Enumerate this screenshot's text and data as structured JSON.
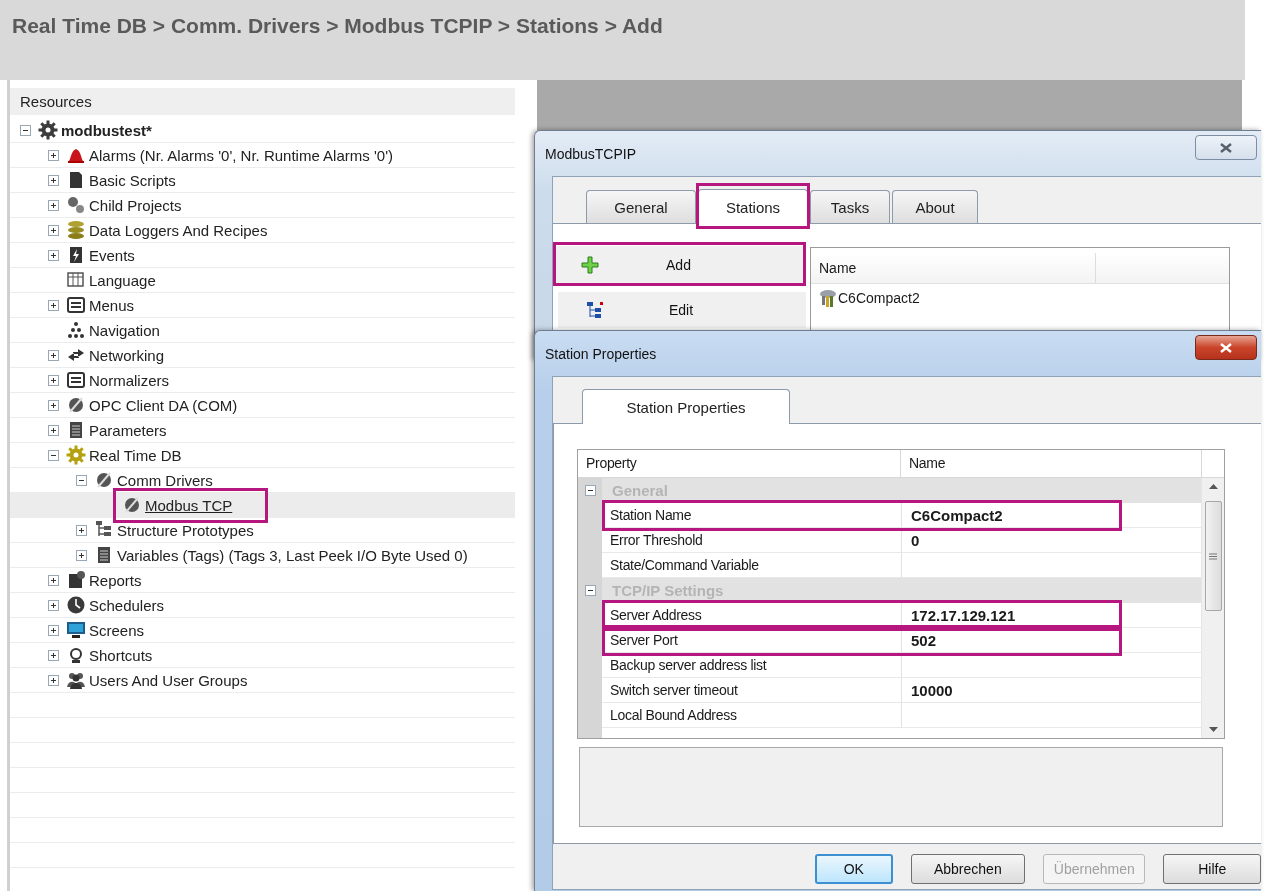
{
  "header": {
    "breadcrumb": "Real Time DB > Comm. Drivers > Modbus TCPIP > Stations > Add"
  },
  "resources": {
    "title": "Resources",
    "tree": [
      {
        "label": "modbustest*",
        "expanded": true,
        "selected": false,
        "highlighted": false,
        "children": [
          {
            "label": "Alarms (Nr. Alarms '0', Nr. Runtime Alarms '0')",
            "expanded": false,
            "selected": false,
            "highlighted": false
          },
          {
            "label": "Basic Scripts",
            "expanded": false,
            "selected": false,
            "highlighted": false
          },
          {
            "label": "Child Projects",
            "expanded": false,
            "selected": false,
            "highlighted": false
          },
          {
            "label": "Data Loggers And Recipes",
            "expanded": false,
            "selected": false,
            "highlighted": false
          },
          {
            "label": "Events",
            "expanded": false,
            "selected": false,
            "highlighted": false
          },
          {
            "label": "Language",
            "selected": false,
            "highlighted": false
          },
          {
            "label": "Menus",
            "expanded": false,
            "selected": false,
            "highlighted": false
          },
          {
            "label": "Navigation",
            "selected": false,
            "highlighted": false
          },
          {
            "label": "Networking",
            "expanded": false,
            "selected": false,
            "highlighted": false
          },
          {
            "label": "Normalizers",
            "expanded": false,
            "selected": false,
            "highlighted": false
          },
          {
            "label": "OPC Client DA (COM)",
            "expanded": false,
            "selected": false,
            "highlighted": false
          },
          {
            "label": "Parameters",
            "expanded": false,
            "selected": false,
            "highlighted": false
          },
          {
            "label": "Real Time DB",
            "expanded": true,
            "selected": false,
            "highlighted": false,
            "children": [
              {
                "label": "Comm Drivers",
                "expanded": true,
                "selected": false,
                "highlighted": false,
                "children": [
                  {
                    "label": "Modbus TCP",
                    "selected": true,
                    "highlighted": true
                  }
                ]
              },
              {
                "label": "Structure Prototypes",
                "expanded": false,
                "selected": false,
                "highlighted": false
              },
              {
                "label": "Variables (Tags) (Tags 3, Last Peek I/O Byte Used 0)",
                "expanded": false,
                "selected": false,
                "highlighted": false
              }
            ]
          },
          {
            "label": "Reports",
            "expanded": false,
            "selected": false,
            "highlighted": false
          },
          {
            "label": "Schedulers",
            "expanded": false,
            "selected": false,
            "highlighted": false
          },
          {
            "label": "Screens",
            "expanded": false,
            "selected": false,
            "highlighted": false
          },
          {
            "label": "Shortcuts",
            "expanded": false,
            "selected": false,
            "highlighted": false
          },
          {
            "label": "Users And User Groups",
            "expanded": false,
            "selected": false,
            "highlighted": false
          }
        ]
      }
    ]
  },
  "driver_window": {
    "title": "ModbusTCPIP",
    "active": false,
    "tabs": [
      {
        "label": "General",
        "selected": false,
        "highlighted": false
      },
      {
        "label": "Stations",
        "selected": true,
        "highlighted": true
      },
      {
        "label": "Tasks",
        "selected": false,
        "highlighted": false
      },
      {
        "label": "About",
        "selected": false,
        "highlighted": false
      }
    ],
    "actions": [
      {
        "label": "Add",
        "highlighted": true
      },
      {
        "label": "Edit",
        "highlighted": false
      }
    ],
    "stations_list": {
      "columns": [
        "Name"
      ],
      "rows": [
        "C6Compact2"
      ]
    }
  },
  "properties_window": {
    "title": "Station Properties",
    "active": true,
    "tabs": [
      {
        "label": "Station Properties",
        "selected": true
      }
    ],
    "grid": {
      "columns": [
        "Property",
        "Name"
      ],
      "groups": [
        {
          "name": "General",
          "expanded": true,
          "rows": [
            {
              "property": "Station Name",
              "value": "C6Compact2",
              "highlighted": true
            },
            {
              "property": "Error Threshold",
              "value": "0",
              "highlighted": false
            },
            {
              "property": "State/Command Variable",
              "highlighted": false
            }
          ]
        },
        {
          "name": "TCP/IP Settings",
          "expanded": true,
          "rows": [
            {
              "property": "Server Address",
              "value": "172.17.129.121",
              "highlighted": true
            },
            {
              "property": "Server Port",
              "value": "502",
              "highlighted": true
            },
            {
              "property": "Backup server address list",
              "highlighted": false
            },
            {
              "property": "Switch server timeout",
              "value": "10000",
              "highlighted": false
            },
            {
              "property": "Local Bound Address",
              "highlighted": false
            }
          ]
        }
      ]
    },
    "buttons": [
      {
        "label": "OK",
        "default": true,
        "disabled": false
      },
      {
        "label": "Abbrechen",
        "default": false,
        "disabled": false
      },
      {
        "label": "Übernehmen",
        "default": false,
        "disabled": true
      },
      {
        "label": "Hilfe",
        "default": false,
        "disabled": false
      }
    ]
  }
}
